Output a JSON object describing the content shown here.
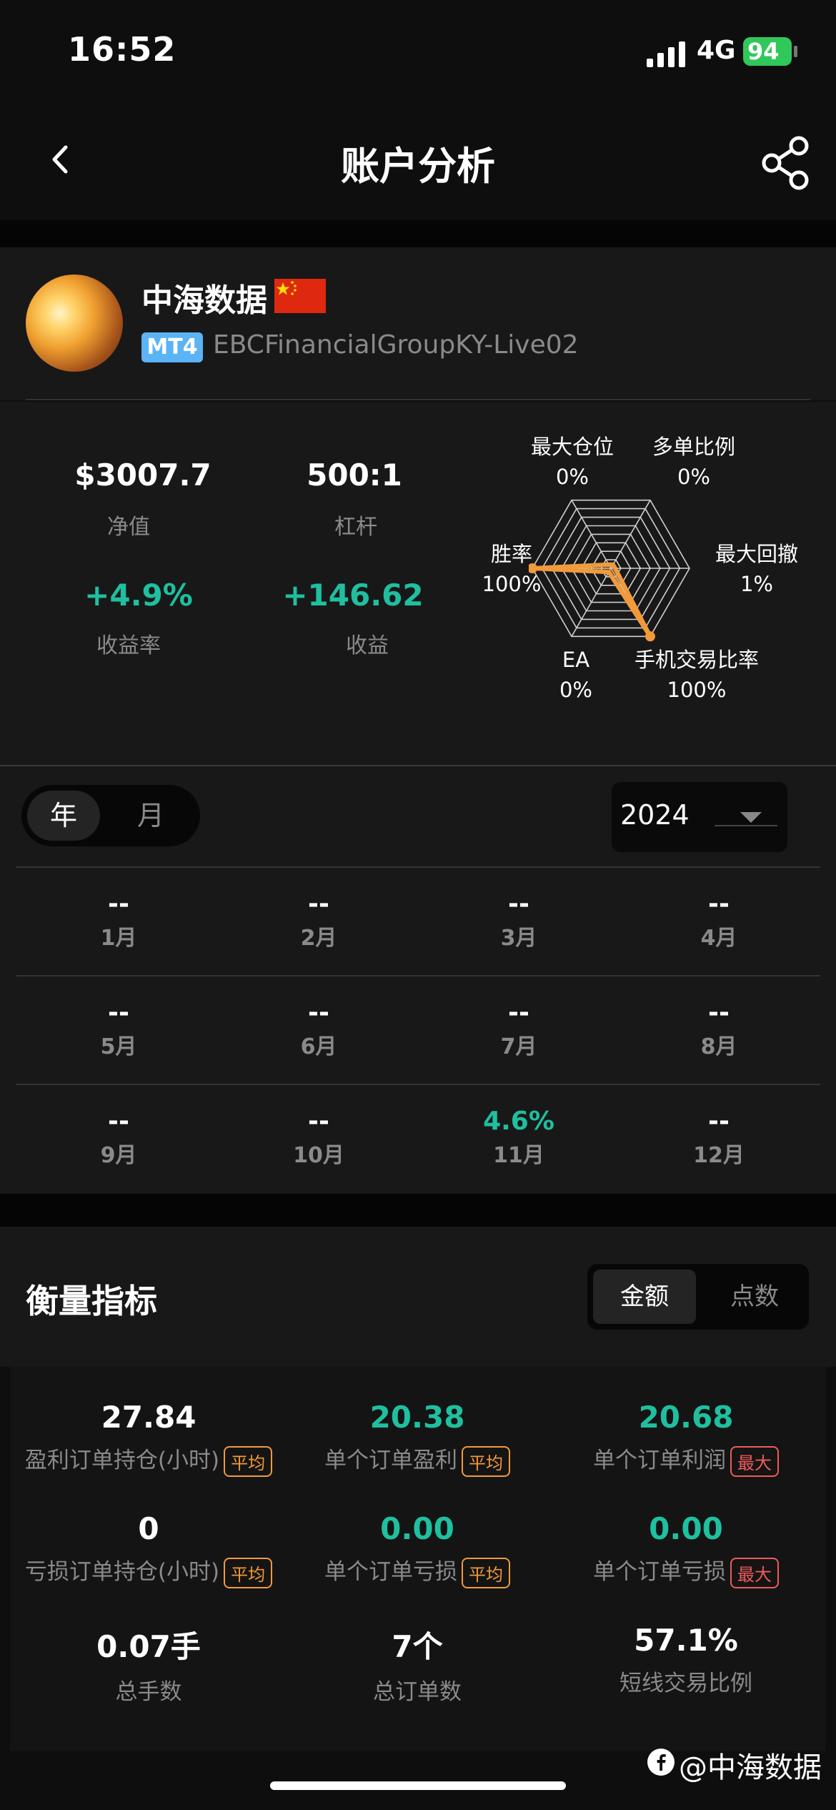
{
  "status": {
    "time": "16:52",
    "network": "4G",
    "battery": "94"
  },
  "nav": {
    "title": "账户分析"
  },
  "profile": {
    "name": "中海数据",
    "platform": "MT4",
    "server": "EBCFinancialGroupKY-Live02"
  },
  "stats": {
    "equity": {
      "value": "$3007.7",
      "label": "净值"
    },
    "leverage": {
      "value": "500:1",
      "label": "杠杆"
    },
    "return_rate": {
      "value": "+4.9%",
      "label": "收益率"
    },
    "profit": {
      "value": "+146.62",
      "label": "收益"
    }
  },
  "radar": {
    "axes": [
      {
        "name": "最大仓位",
        "value": "0%",
        "fraction": 0
      },
      {
        "name": "多单比例",
        "value": "0%",
        "fraction": 0
      },
      {
        "name": "最大回撤",
        "value": "1%",
        "fraction": 0.01
      },
      {
        "name": "手机交易比率",
        "value": "100%",
        "fraction": 1
      },
      {
        "name": "EA",
        "value": "0%",
        "fraction": 0
      },
      {
        "name": "胜率",
        "value": "100%",
        "fraction": 1
      }
    ],
    "color": "#f29a3a"
  },
  "period_toggle": {
    "year": "年",
    "month": "月",
    "selected": "年"
  },
  "year_select": {
    "value": "2024"
  },
  "months": [
    {
      "name": "1月",
      "value": "--"
    },
    {
      "name": "2月",
      "value": "--"
    },
    {
      "name": "3月",
      "value": "--"
    },
    {
      "name": "4月",
      "value": "--"
    },
    {
      "name": "5月",
      "value": "--"
    },
    {
      "name": "6月",
      "value": "--"
    },
    {
      "name": "7月",
      "value": "--"
    },
    {
      "name": "8月",
      "value": "--"
    },
    {
      "name": "9月",
      "value": "--"
    },
    {
      "name": "10月",
      "value": "--"
    },
    {
      "name": "11月",
      "value": "4.6%"
    },
    {
      "name": "12月",
      "value": "--"
    }
  ],
  "metrics": {
    "title": "衡量指标",
    "seg_amount": "金额",
    "seg_points": "点数",
    "tag_avg": "平均",
    "tag_max": "最大",
    "items": [
      {
        "value": "27.84",
        "label": "盈利订单持仓(小时)"
      },
      {
        "value": "20.38",
        "label": "单个订单盈利"
      },
      {
        "value": "20.68",
        "label": "单个订单利润"
      },
      {
        "value": "0",
        "label": "亏损订单持仓(小时)"
      },
      {
        "value": "0.00",
        "label": "单个订单亏损"
      },
      {
        "value": "0.00",
        "label": "单个订单亏损"
      },
      {
        "value": "0.07手",
        "label": "总手数"
      },
      {
        "value": "7个",
        "label": "总订单数"
      },
      {
        "value": "57.1%",
        "label": "短线交易比例"
      }
    ]
  },
  "watermark": "@中海数据",
  "colors": {
    "green": "#1fbf9f",
    "accent": "#f29a3a",
    "badge_blue": "#5ab4f5"
  }
}
